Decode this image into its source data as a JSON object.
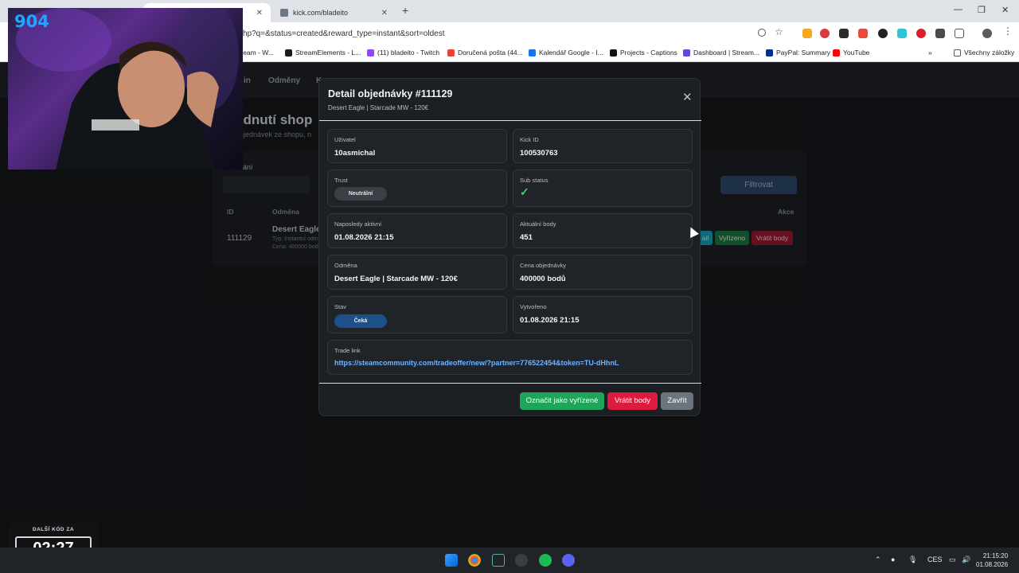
{
  "browser": {
    "tabs": [
      {
        "title": "",
        "active": true
      },
      {
        "title": "kick.com/bladeito",
        "active": false
      }
    ],
    "url": "hp?q=&status=created&reward_type=instant&sort=oldest",
    "bookmarks": [
      {
        "label": "tream - W...",
        "color": "#8a8a8a"
      },
      {
        "label": "StreamElements - L...",
        "color": "#1b1b1b"
      },
      {
        "label": "(11) bladeito - Twitch",
        "color": "#9146ff"
      },
      {
        "label": "Doručená pošta (44...",
        "color": "#ea4335"
      },
      {
        "label": "Kalendář Google - I...",
        "color": "#1a73e8"
      },
      {
        "label": "Projects - Captions",
        "color": "#111111"
      },
      {
        "label": "Dashboard | Stream...",
        "color": "#5b4bdb"
      },
      {
        "label": "PayPal: Summary",
        "color": "#003087"
      },
      {
        "label": "YouTube",
        "color": "#ff0000"
      }
    ],
    "all_bookmarks": "Všechny záložky"
  },
  "page": {
    "nav": [
      "in",
      "Odměny",
      "K"
    ],
    "title": "ednutí shop",
    "subtitle": "objednávek ze shopu, n",
    "filter_label": "dání",
    "filter_button": "Filtrovat",
    "table": {
      "headers": {
        "id": "ID",
        "reward": "Odměna",
        "actions": "Akce"
      },
      "row": {
        "id": "111129",
        "reward": "Desert Eagle",
        "type": "Typ: Instantní odm",
        "price": "Cena: 400000 bodů",
        "detail_btn": "ail",
        "done_btn": "Vyřízeno",
        "refund_btn": "Vrátit body"
      }
    }
  },
  "modal": {
    "title": "Detail objednávky #111129",
    "subtitle": "Desert Eagle | Starcade MW - 120€",
    "fields": {
      "user_label": "Uživatel",
      "user_value": "10asmichal",
      "kick_label": "Kick ID",
      "kick_value": "100530763",
      "trust_label": "Trust",
      "trust_value": "Neutrální",
      "sub_label": "Sub status",
      "sub_icon": "check-icon",
      "last_active_label": "Naposledy aktivní",
      "last_active_value": "01.08.2026 21:15",
      "points_label": "Aktuální body",
      "points_value": "451",
      "reward_label": "Odměna",
      "reward_value": "Desert Eagle | Starcade MW - 120€",
      "price_label": "Cena objednávky",
      "price_value": "400000 bodů",
      "state_label": "Stav",
      "state_value": "Čeká",
      "created_label": "Vytvořeno",
      "created_value": "01.08.2026 21:15",
      "trade_label": "Trade link",
      "trade_value": "https://steamcommunity.com/tradeoffer/new/?partner=776522454&token=TU-dHhnL"
    },
    "buttons": {
      "mark_done": "Označit jako vyřízené",
      "refund": "Vrátit body",
      "close": "Zavřít"
    },
    "colors": {
      "green": "#1fa55a",
      "red": "#dc1c3e",
      "gray": "#6c757d"
    }
  },
  "overlay": {
    "counter": "904",
    "countdown_label": "DALŠÍ KÓD ZA",
    "countdown_time": "02:27"
  },
  "taskbar": {
    "language": "CES",
    "time": "21:15:20",
    "date": "01.08.2026"
  }
}
